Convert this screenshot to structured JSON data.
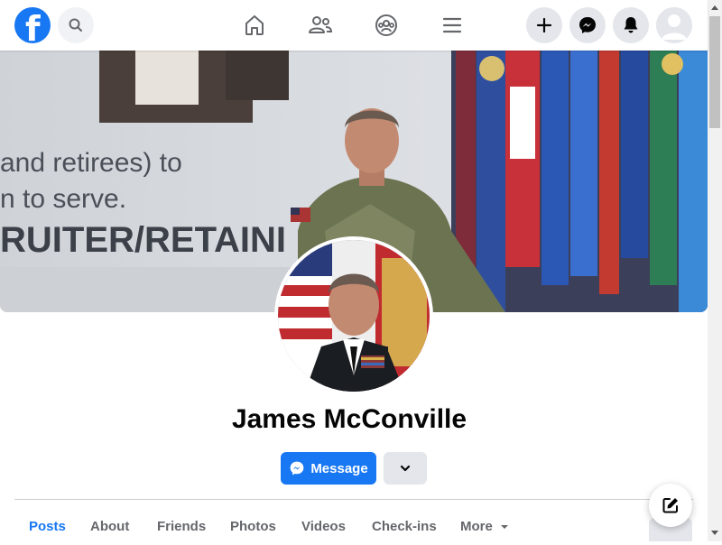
{
  "topbar": {
    "logo_letter": "f",
    "icons": {
      "logo": "facebook-logo-icon",
      "search": "search-icon",
      "home": "home-icon",
      "friends": "friends-icon",
      "groups": "groups-icon",
      "menu": "menu-icon",
      "create": "plus-icon",
      "messenger": "messenger-icon",
      "notifications": "bell-icon",
      "account": "avatar-icon"
    }
  },
  "cover": {
    "slide_lines": [
      "and retirees) to",
      "n to serve.",
      "RUITER/RETAINI"
    ]
  },
  "profile": {
    "name": "James McConville"
  },
  "actions": {
    "message_label": "Message",
    "more_icon": "chevron-down-icon"
  },
  "tabs": [
    {
      "label": "Posts",
      "active": true
    },
    {
      "label": "About",
      "active": false
    },
    {
      "label": "Friends",
      "active": false
    },
    {
      "label": "Photos",
      "active": false
    },
    {
      "label": "Videos",
      "active": false
    },
    {
      "label": "Check-ins",
      "active": false
    },
    {
      "label": "More",
      "active": false
    }
  ],
  "floating": {
    "compose_icon": "edit-icon"
  },
  "colors": {
    "brand": "#1877f2",
    "button_gray": "#e4e6eb",
    "text_secondary": "#65676b"
  }
}
